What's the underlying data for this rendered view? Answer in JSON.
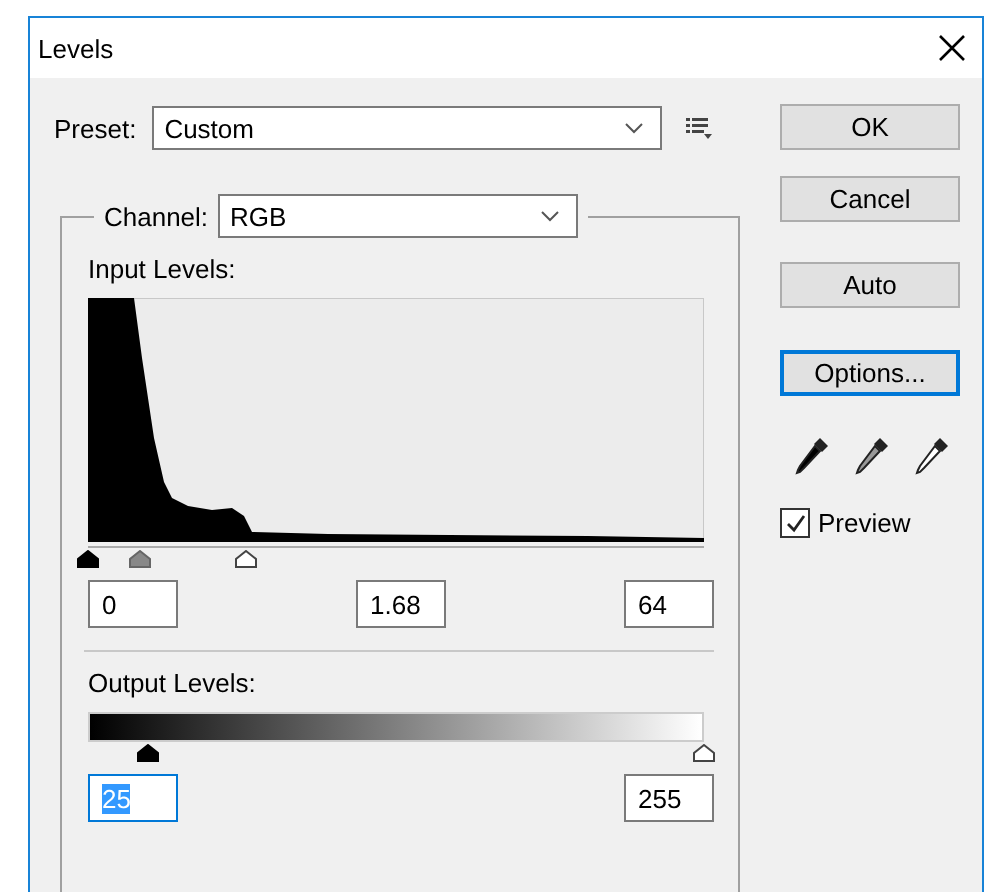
{
  "window": {
    "title": "Levels"
  },
  "preset": {
    "label": "Preset:",
    "value": "Custom"
  },
  "channel": {
    "label": "Channel:",
    "value": "RGB"
  },
  "input_levels": {
    "label": "Input Levels:",
    "sliders": [
      {
        "kind": "black",
        "level": 0
      },
      {
        "kind": "gray",
        "level": 0.084
      },
      {
        "kind": "white",
        "level": 0.256
      }
    ],
    "fields": [
      {
        "value": "0",
        "selected": false
      },
      {
        "value": "1.68",
        "selected": false
      },
      {
        "value": "64",
        "selected": false
      }
    ]
  },
  "output_levels": {
    "label": "Output Levels:",
    "sliders": [
      {
        "kind": "black",
        "level": 0.098
      },
      {
        "kind": "white",
        "level": 1
      }
    ],
    "fields": [
      {
        "value": "25",
        "selected": true
      },
      {
        "value": "255",
        "selected": false
      }
    ]
  },
  "buttons": [
    {
      "label": "OK",
      "focused": false
    },
    {
      "label": "Cancel",
      "focused": false
    },
    {
      "label": "Auto",
      "focused": false
    },
    {
      "label": "Options...",
      "focused": true
    }
  ],
  "eyedroppers": [
    {
      "kind": "black"
    },
    {
      "kind": "gray"
    },
    {
      "kind": "white"
    }
  ],
  "preview": {
    "label": "Preview",
    "checked": true
  }
}
